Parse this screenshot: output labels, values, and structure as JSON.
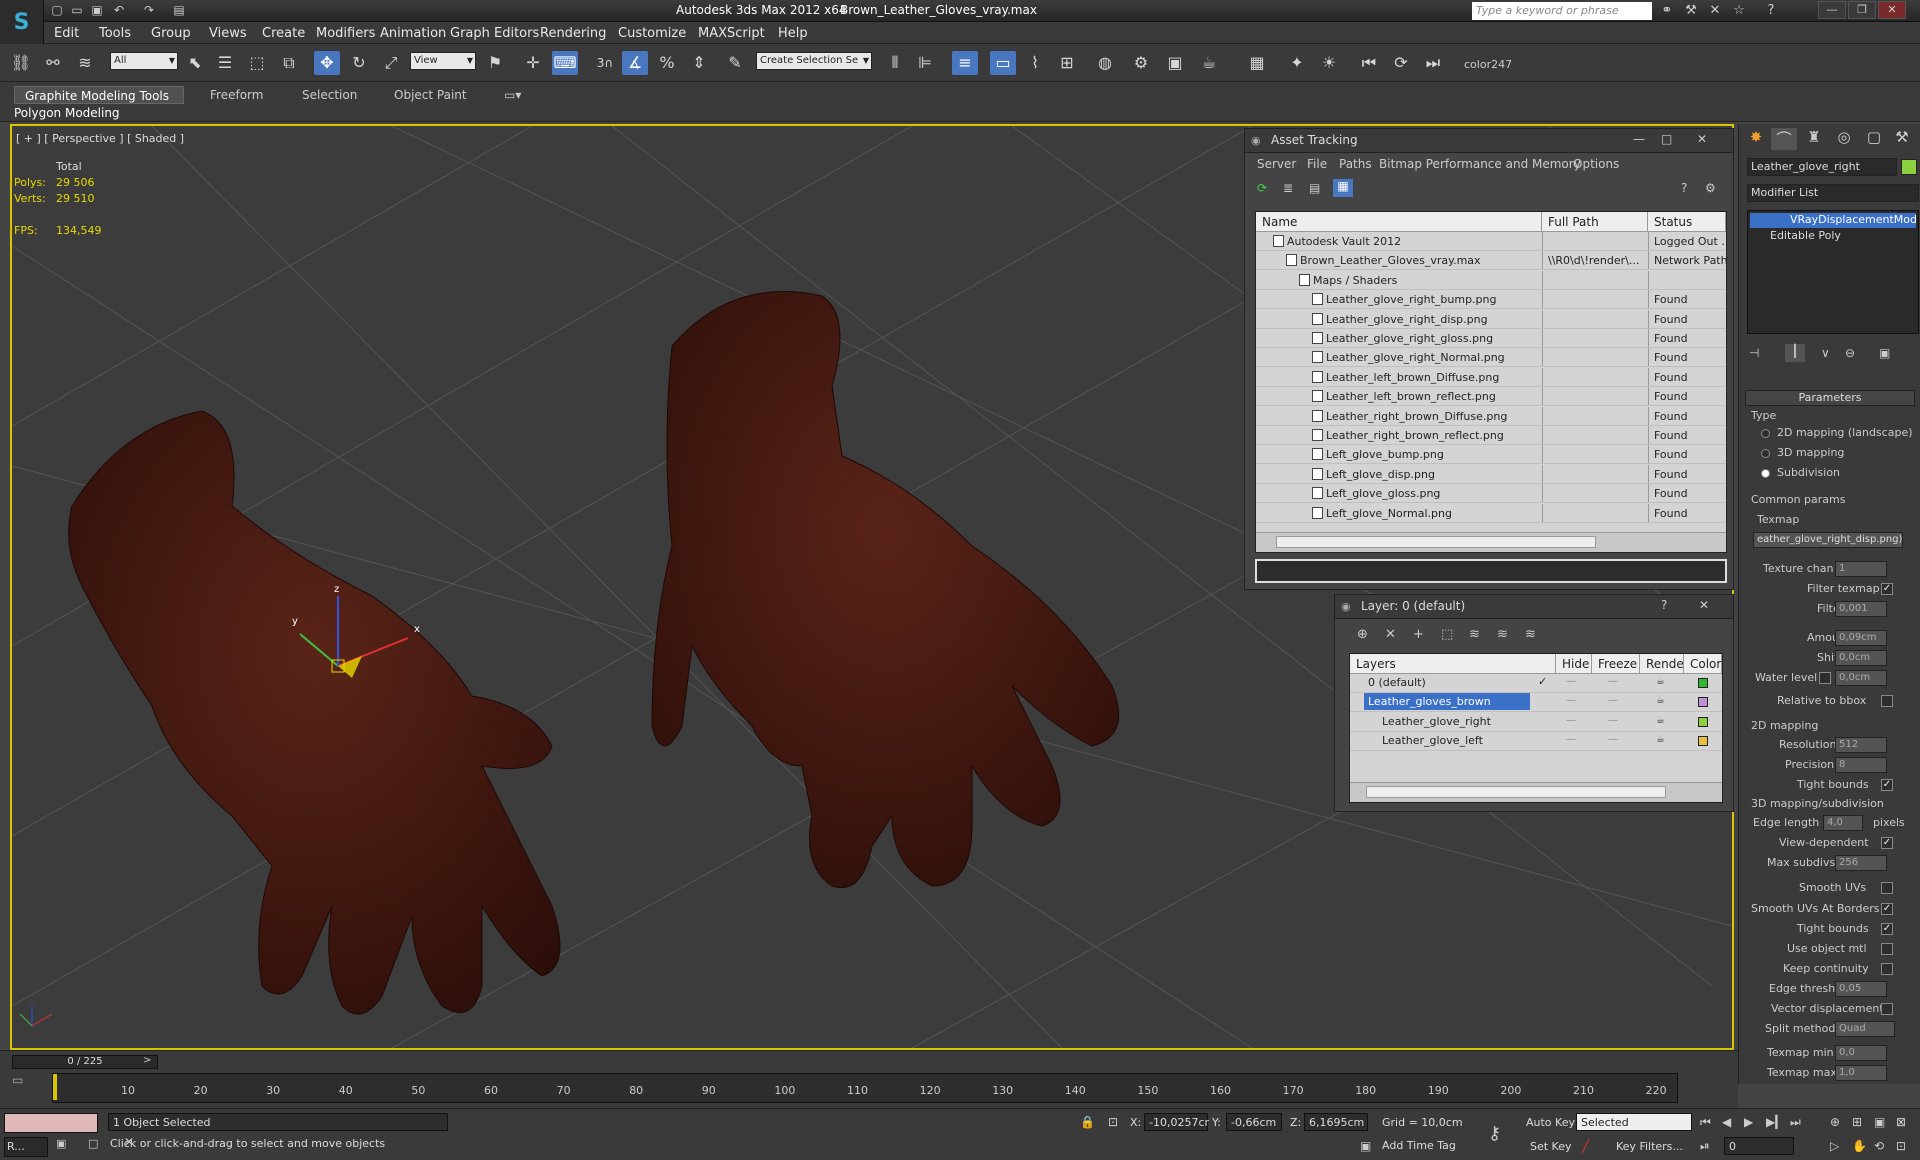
{
  "titlebar": {
    "app_title": "Autodesk 3ds Max  2012 x64",
    "file_title": "Brown_Leather_Gloves_vray.max",
    "search_placeholder": "Type a keyword or phrase"
  },
  "menu": [
    "Edit",
    "Tools",
    "Group",
    "Views",
    "Create",
    "Modifiers",
    "Animation",
    "Graph Editors",
    "Rendering",
    "Customize",
    "MAXScript",
    "Help"
  ],
  "toolbar": {
    "selection_filter": "All",
    "ref_coord": "View",
    "named_selection": "Create Selection Se",
    "snap_label": "3",
    "color_label": "color247"
  },
  "ribbon": {
    "tabs": [
      "Graphite Modeling Tools",
      "Freeform",
      "Selection",
      "Object Paint"
    ],
    "sub_label": "Polygon Modeling"
  },
  "viewport": {
    "label": "[ + ] [ Perspective ] [ Shaded ]",
    "stats_header": "Total",
    "polys_label": "Polys:",
    "polys_value": "29 506",
    "verts_label": "Verts:",
    "verts_value": "29 510",
    "fps_label": "FPS:",
    "fps_value": "134,549",
    "gizmo_x": "x",
    "gizmo_y": "y",
    "gizmo_z": "z"
  },
  "asset_tracking": {
    "title": "Asset Tracking",
    "menu": [
      "Server",
      "File",
      "Paths",
      "Bitmap Performance and Memory",
      "Options"
    ],
    "columns": [
      "Name",
      "Full Path",
      "Status"
    ],
    "rows": [
      {
        "name": "Autodesk Vault 2012",
        "path": "",
        "status": "Logged Out ..",
        "indent": 1
      },
      {
        "name": "Brown_Leather_Gloves_vray.max",
        "path": "\\\\R0\\d\\!render\\...",
        "status": "Network Path",
        "indent": 2
      },
      {
        "name": "Maps / Shaders",
        "path": "",
        "status": "",
        "indent": 3
      },
      {
        "name": "Leather_glove_right_bump.png",
        "path": "",
        "status": "Found",
        "indent": 4
      },
      {
        "name": "Leather_glove_right_disp.png",
        "path": "",
        "status": "Found",
        "indent": 4
      },
      {
        "name": "Leather_glove_right_gloss.png",
        "path": "",
        "status": "Found",
        "indent": 4
      },
      {
        "name": "Leather_glove_right_Normal.png",
        "path": "",
        "status": "Found",
        "indent": 4
      },
      {
        "name": "Leather_left_brown_Diffuse.png",
        "path": "",
        "status": "Found",
        "indent": 4
      },
      {
        "name": "Leather_left_brown_reflect.png",
        "path": "",
        "status": "Found",
        "indent": 4
      },
      {
        "name": "Leather_right_brown_Diffuse.png",
        "path": "",
        "status": "Found",
        "indent": 4
      },
      {
        "name": "Leather_right_brown_reflect.png",
        "path": "",
        "status": "Found",
        "indent": 4
      },
      {
        "name": "Left_glove_bump.png",
        "path": "",
        "status": "Found",
        "indent": 4
      },
      {
        "name": "Left_glove_disp.png",
        "path": "",
        "status": "Found",
        "indent": 4
      },
      {
        "name": "Left_glove_gloss.png",
        "path": "",
        "status": "Found",
        "indent": 4
      },
      {
        "name": "Left_glove_Normal.png",
        "path": "",
        "status": "Found",
        "indent": 4
      }
    ]
  },
  "layer_manager": {
    "title": "Layer: 0 (default)",
    "columns": [
      "Layers",
      "Hide",
      "Freeze",
      "Render",
      "Color"
    ],
    "rows": [
      {
        "name": "0 (default)",
        "color": "#2db82d",
        "selected": false,
        "indent": 1
      },
      {
        "name": "Leather_gloves_brown",
        "color": "#c090d8",
        "selected": true,
        "indent": 1
      },
      {
        "name": "Leather_glove_right",
        "color": "#8cd040",
        "selected": false,
        "indent": 2
      },
      {
        "name": "Leather_glove_left",
        "color": "#e8c040",
        "selected": false,
        "indent": 2
      }
    ]
  },
  "command_panel": {
    "object_name": "Leather_glove_right",
    "modifier_list": "Modifier List",
    "stack": [
      "VRayDisplacementMod",
      "Editable Poly"
    ],
    "rollout_title": "Parameters",
    "type_label": "Type",
    "type_options": [
      "2D mapping (landscape)",
      "3D mapping",
      "Subdivision"
    ],
    "common_params": "Common params",
    "texmap_label": "Texmap",
    "texmap_value": "eather_glove_right_disp.png)",
    "texture_chan_label": "Texture chan",
    "texture_chan_value": "1",
    "filter_texmap_label": "Filter texmap",
    "filter_blur_label": "Filter blur",
    "filter_blur_value": "0,001",
    "amount_label": "Amount",
    "amount_value": "0,09cm",
    "shift_label": "Shift",
    "shift_value": "0,0cm",
    "water_label": "Water level",
    "water_value": "0,0cm",
    "relative_bbox": "Relative to bbox",
    "mapping2d": "2D mapping",
    "resolution_label": "Resolution",
    "resolution_value": "512",
    "precision_label": "Precision",
    "precision_value": "8",
    "tight_bounds": "Tight bounds",
    "mapping3d": "3D mapping/subdivision",
    "edge_length_label": "Edge length",
    "edge_length_value": "4,0",
    "pixels_label": "pixels",
    "view_dependent": "View-dependent",
    "max_subdivs_label": "Max subdivs",
    "max_subdivs_value": "256",
    "smooth_uvs": "Smooth UVs",
    "smooth_uvs_borders": "Smooth UVs At Borders",
    "tight_bounds2": "Tight bounds",
    "use_object_mtl": "Use object mtl",
    "keep_continuity": "Keep continuity",
    "edge_thresh_label": "Edge thresh",
    "edge_thresh_value": "0,05",
    "vector_disp": "Vector displacement",
    "split_method_label": "Split method",
    "split_method_value": "Quad",
    "texmap_min_label": "Texmap min:",
    "texmap_min_value": "0,0",
    "texmap_max_label": "Texmap max:",
    "texmap_max_value": "1,0"
  },
  "timeline": {
    "frame_counter": "0 / 225",
    "ticks": [
      "10",
      "20",
      "30",
      "40",
      "50",
      "60",
      "70",
      "80",
      "90",
      "100",
      "110",
      "120",
      "130",
      "140",
      "150",
      "160",
      "170",
      "180",
      "190",
      "200",
      "210",
      "220"
    ]
  },
  "status": {
    "selection": "1 Object Selected",
    "prompt": "Click or click-and-drag to select and move objects",
    "x_label": "X:",
    "x_value": "-10,0257cr",
    "y_label": "Y:",
    "y_value": "-0,66cm",
    "z_label": "Z:",
    "z_value": "6,1695cm",
    "grid": "Grid = 10,0cm",
    "auto_key": "Auto Key",
    "set_key": "Set Key",
    "selected_dd": "Selected",
    "key_filters": "Key Filters...",
    "add_time_tag": "Add Time Tag",
    "frame_value": "0",
    "taskbar_label": "R..."
  }
}
